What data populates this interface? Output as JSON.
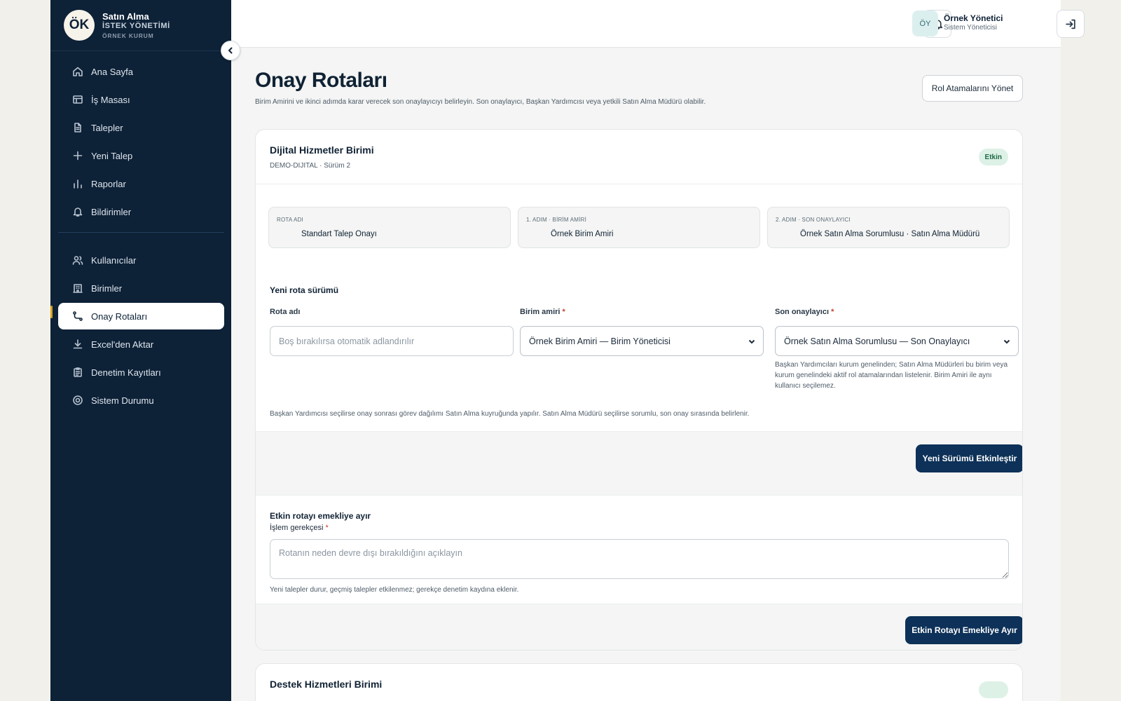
{
  "brand": {
    "logo": "ÖK",
    "title": "Satın Alma",
    "subtitle": "İSTEK YÖNETİMİ",
    "org": "ÖRNEK KURUM"
  },
  "sidebar": {
    "items_primary": [
      {
        "label": "Ana Sayfa",
        "icon": "home-icon"
      },
      {
        "label": "İş Masası",
        "icon": "table-icon"
      },
      {
        "label": "Talepler",
        "icon": "document-icon"
      },
      {
        "label": "Yeni Talep",
        "icon": "plus-icon"
      },
      {
        "label": "Raporlar",
        "icon": "bar-chart-icon"
      },
      {
        "label": "Bildirimler",
        "icon": "bell-icon"
      }
    ],
    "items_admin": [
      {
        "label": "Kullanıcılar",
        "icon": "users-icon"
      },
      {
        "label": "Birimler",
        "icon": "building-icon"
      },
      {
        "label": "Onay Rotaları",
        "icon": "route-icon",
        "active": true
      },
      {
        "label": "Excel'den Aktar",
        "icon": "download-icon"
      },
      {
        "label": "Denetim Kayıtları",
        "icon": "clipboard-icon"
      },
      {
        "label": "Sistem Durumu",
        "icon": "status-icon"
      }
    ]
  },
  "topbar": {
    "avatar": "ÖY",
    "user_name": "Örnek Yönetici",
    "user_role": "Sistem Yöneticisi"
  },
  "page": {
    "title": "Onay Rotaları",
    "description": "Birim Amirini ve ikinci adımda karar verecek son onaylayıcıyı belirleyin. Son onaylayıcı, Başkan Yardımcısı veya yetkili Satın Alma Müdürü olabilir.",
    "manage_roles_button": "Rol Atamalarını Yönet"
  },
  "unit_card": {
    "title": "Dijital Hizmetler Birimi",
    "subtitle": "DEMO-DIJITAL · Sürüm 2",
    "badge": "Etkin",
    "info": [
      {
        "label": "ROTA ADI",
        "value": "Standart Talep Onayı"
      },
      {
        "label": "1. ADIM · BİRİM AMİRİ",
        "value": "Örnek Birim Amiri"
      },
      {
        "label": "2. ADIM · SON ONAYLAYICI",
        "value": "Örnek Satın Alma Sorumlusu · Satın Alma Müdürü"
      }
    ],
    "new_version": {
      "section_title": "Yeni rota sürümü",
      "route_name_label": "Rota adı",
      "route_name_placeholder": "Boş bırakılırsa otomatik adlandırılır",
      "unit_manager_label": "Birim amiri",
      "unit_manager_value": "Örnek Birim Amiri — Birim Yöneticisi",
      "final_approver_label": "Son onaylayıcı",
      "final_approver_value": "Örnek Satın Alma Sorumlusu — Son Onaylayıcı",
      "final_approver_help": "Başkan Yardımcıları kurum genelinden; Satın Alma Müdürleri bu birim veya kurum genelindeki aktif rol atamalarından listelenir. Birim Amiri ile aynı kullanıcı seçilemez.",
      "footnote": "Başkan Yardımcısı seçilirse onay sonrası görev dağılımı Satın Alma kuyruğunda yapılır. Satın Alma Müdürü seçilirse sorumlu, son onay sırasında belirlenir.",
      "activate_button": "Yeni Sürümü Etkinleştir",
      "required_mark": "*"
    },
    "retire": {
      "section_title": "Etkin rotayı emekliye ayır",
      "reason_label": "İşlem gerekçesi",
      "reason_placeholder": "Rotanın neden devre dışı bırakıldığını açıklayın",
      "help": "Yeni talepler durur, geçmiş talepler etkilenmez; gerekçe denetim kaydına eklenir.",
      "retire_button": "Etkin Rotayı Emekliye Ayır"
    }
  },
  "unit_card_2": {
    "title": "Destek Hizmetleri Birimi"
  }
}
